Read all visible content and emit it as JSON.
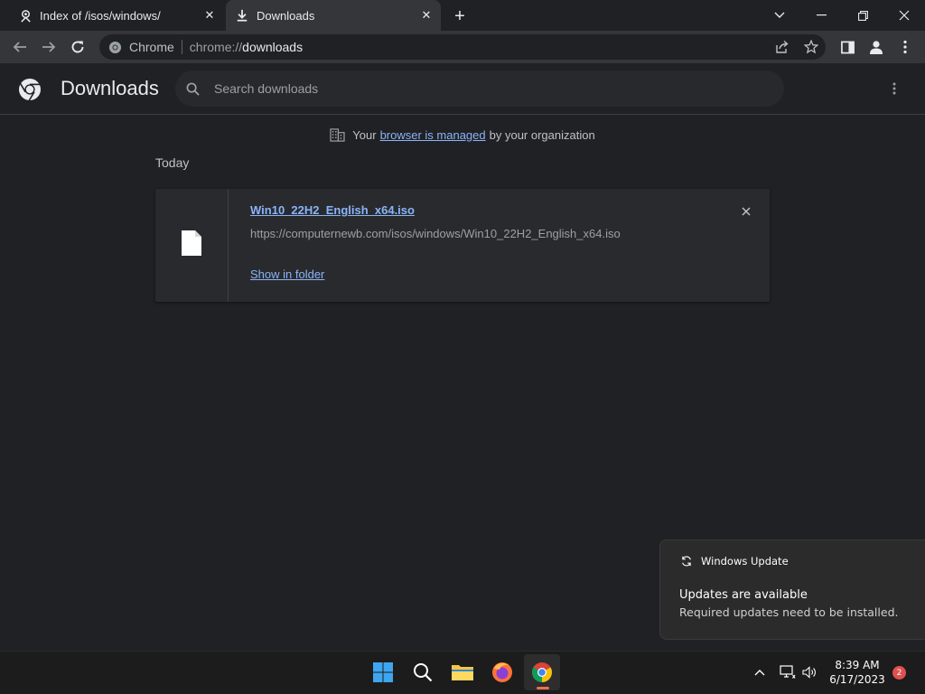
{
  "tabs": [
    {
      "title": "Index of /isos/windows/",
      "icon": "webpage-icon",
      "active": false
    },
    {
      "title": "Downloads",
      "icon": "download-icon",
      "active": true
    }
  ],
  "omnibox": {
    "chip": "Chrome",
    "url_scheme": "chrome://",
    "url_host": "downloads"
  },
  "page": {
    "title": "Downloads",
    "search_placeholder": "Search downloads",
    "managed_prefix": "Your",
    "managed_link": "browser is managed",
    "managed_suffix": "by your organization",
    "date_header": "Today"
  },
  "download": {
    "file_name": "Win10_22H2_English_x64.iso",
    "url": "https://computernewb.com/isos/windows/Win10_22H2_English_x64.iso",
    "action": "Show in folder"
  },
  "toast": {
    "app": "Windows Update",
    "title": "Updates are available",
    "body": "Required updates need to be installed."
  },
  "taskbar": {
    "time": "8:39 AM",
    "date": "6/17/2023",
    "notifications": "2"
  },
  "colors": {
    "accent": "#8ab4f8",
    "background": "#202124",
    "toolbar": "#35363a"
  }
}
